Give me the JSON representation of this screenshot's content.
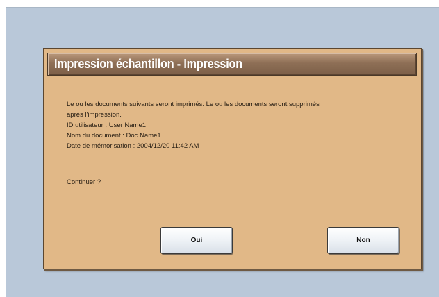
{
  "dialog": {
    "title": "Impression échantillon - Impression",
    "message_line1": "Le ou les documents suivants seront imprimés. Le ou les documents seront supprimés",
    "message_line2": "après l'impression.",
    "user_id": "ID utilisateur : User Name1",
    "document_name": "Nom du document : Doc Name1",
    "stored_date": "Date de mémorisation : 2004/12/20 11:42 AM",
    "prompt": "Continuer ?",
    "yes_label": "Oui",
    "no_label": "Non"
  },
  "colors": {
    "screen_background": "#b9c8d9",
    "dialog_background": "#e1b887",
    "title_bar": "#8e6f56"
  }
}
